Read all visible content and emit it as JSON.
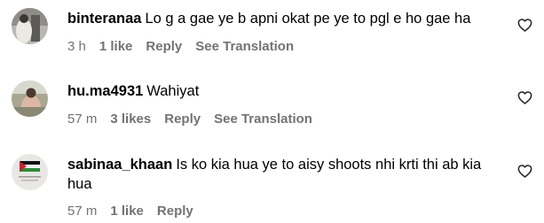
{
  "actions": {
    "reply": "Reply",
    "see_translation": "See Translation"
  },
  "comments": [
    {
      "username": "binteranaa",
      "text": "Lo g a gae ye b apni okat pe ye to pgl e ho gae ha",
      "time": "3 h",
      "likes": "1 like",
      "avatar_icon": "profile-photo"
    },
    {
      "username": "hu.ma4931",
      "text": "Wahiyat",
      "time": "57 m",
      "likes": "3 likes",
      "avatar_icon": "profile-photo"
    },
    {
      "username": "sabinaa_khaan",
      "text_line1": "Is ko kia hua ye to aisy shoots nhi krti thi ab kia",
      "text_line2": "hua",
      "time": "57 m",
      "likes": "1 like",
      "avatar_icon": "palestine-flag-photo"
    }
  ],
  "colors": {
    "meta_text": "#737373",
    "text": "#000000",
    "background": "#ffffff"
  }
}
